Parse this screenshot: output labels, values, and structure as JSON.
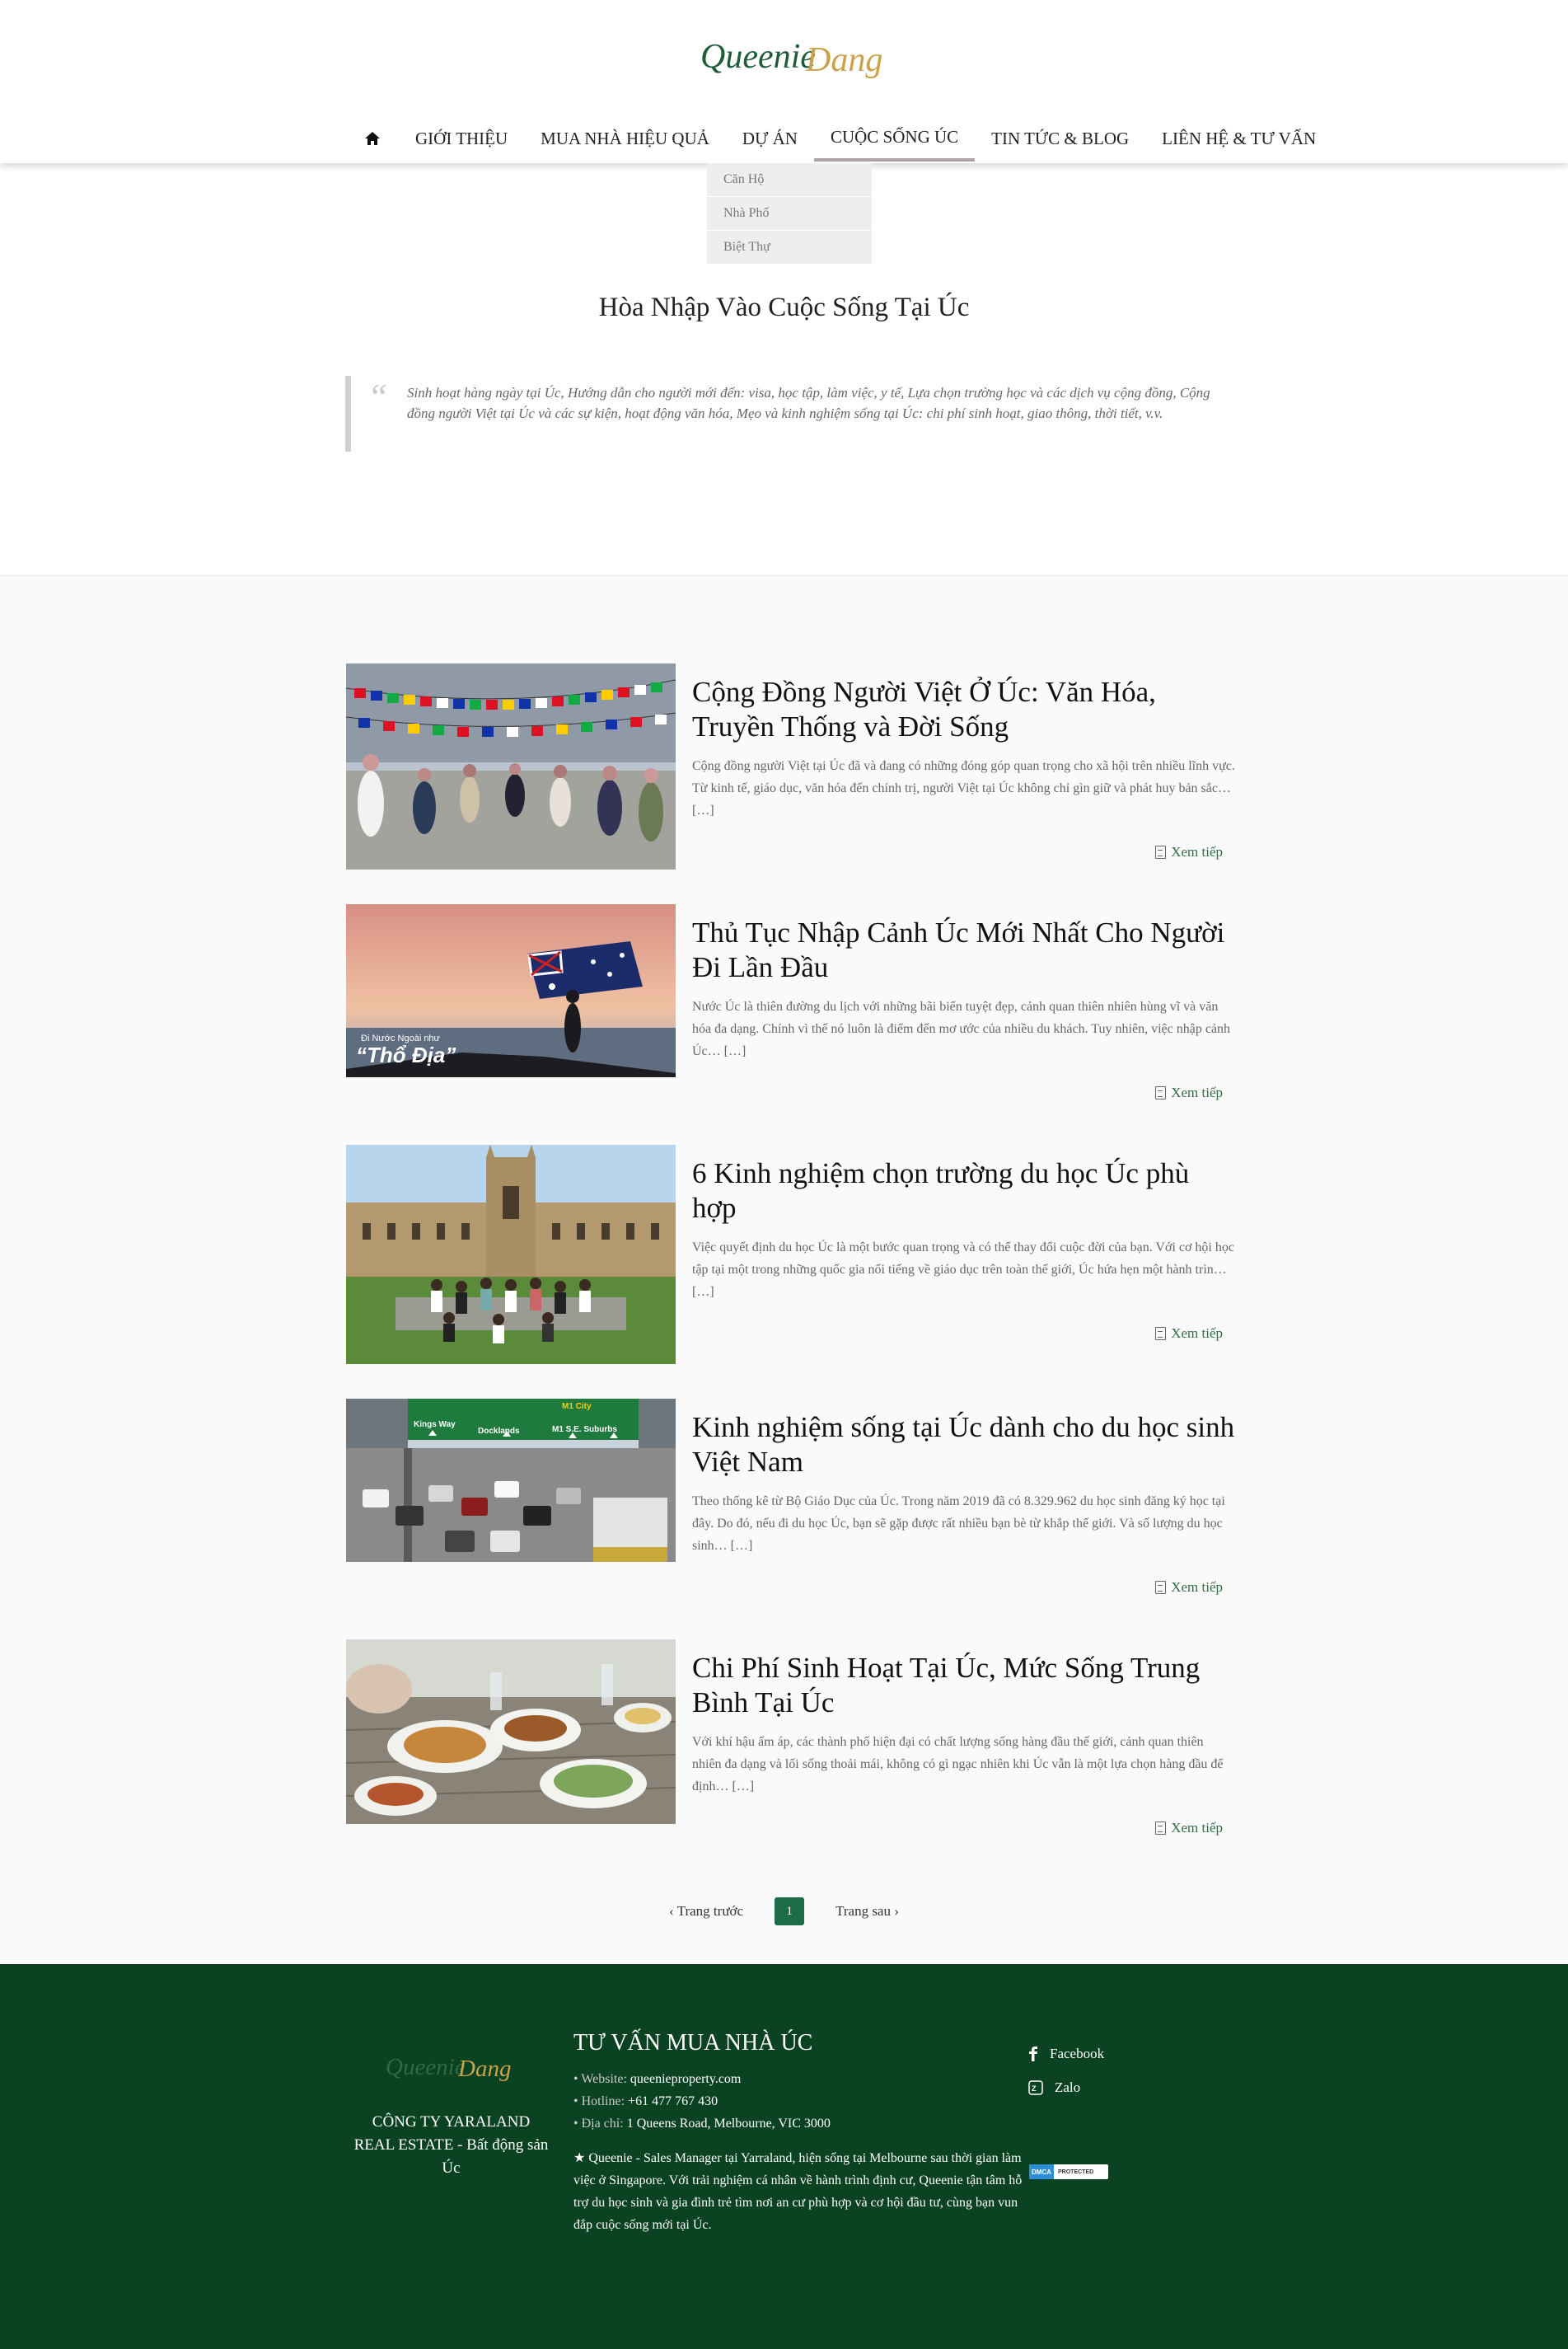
{
  "header": {
    "logo_text_1": "Queenie",
    "logo_text_2": "Dang",
    "nav": [
      {
        "label": "Giới thiệu"
      },
      {
        "label": "Mua nhà hiệu quả"
      },
      {
        "label": "Dự án"
      },
      {
        "label": "Cuộc sống Úc"
      },
      {
        "label": "Tin tức & Blog"
      },
      {
        "label": "Liên hệ & Tư vấn"
      }
    ],
    "dropdown": [
      "Căn Hộ",
      "Nhà Phố",
      "Biệt Thự"
    ]
  },
  "intro": {
    "title": "Hòa Nhập Vào Cuộc Sống Tại Úc",
    "quote": "Sinh hoạt hàng ngày tại Úc, Hướng dẫn cho người mới đến: visa, học tập, làm việc, y tế, Lựa chọn trường học và các dịch vụ cộng đồng, Cộng đồng người Việt tại Úc và các sự kiện, hoạt động văn hóa, Mẹo và kinh nghiệm sống tại Úc: chi phí sinh hoạt, giao thông, thời tiết, v.v."
  },
  "posts": [
    {
      "title": "Cộng Đồng Người Việt Ở Úc: Văn Hóa, Truyền Thống và Đời Sống",
      "excerpt": "Cộng đồng người Việt tại Úc đã và đang có những đóng góp quan trọng cho xã hội trên nhiều lĩnh vực. Từ kinh tế, giáo dục, văn hóa đến chính trị, người Việt tại Úc không chỉ gìn giữ và phát huy bản sắc… […]",
      "read_more": "Xem tiếp"
    },
    {
      "title": "Thủ Tục Nhập Cảnh Úc Mới Nhất Cho Người Đi Lần Đầu",
      "excerpt": "Nước Úc là thiên đường du lịch với những bãi biển tuyệt đẹp, cảnh quan thiên nhiên hùng vĩ và văn hóa đa dạng. Chính vì thế nó luôn là điểm đến mơ ước của nhiều du khách. Tuy nhiên, việc nhập cảnh Úc… […]",
      "read_more": "Xem tiếp",
      "image_caption_1": "Đi Nước Ngoài như",
      "image_caption_2": "“Thổ Địa”"
    },
    {
      "title": "6 Kinh nghiệm chọn trường du học Úc phù hợp",
      "excerpt": "Việc quyết định du học Úc là một bước quan trọng và có thể thay đổi cuộc đời của bạn. Với cơ hội học tập tại một trong những quốc gia nổi tiếng về giáo dục trên toàn thế giới, Úc hứa hẹn một hành trìn… […]",
      "read_more": "Xem tiếp"
    },
    {
      "title": "Kinh nghiệm sống tại Úc dành cho du học sinh Việt Nam",
      "excerpt": "Theo thống kê từ Bộ Giáo Dục của Úc. Trong năm 2019 đã có 8.329.962 du học sinh đăng ký học tại đây. Do đó, nếu đi du học Úc, bạn sẽ gặp được rất nhiều bạn bè từ khắp thế giới. Và số lượng du học sinh… […]",
      "read_more": "Xem tiếp",
      "sign_1": "Kings Way",
      "sign_2": "Docklands",
      "sign_3": "M1 City",
      "sign_4": "M1 S.E. Suburbs"
    },
    {
      "title": "Chi Phí Sinh Hoạt Tại Úc, Mức Sống Trung Bình Tại Úc",
      "excerpt": "Với khí hậu ấm áp, các thành phố hiện đại có chất lượng sống hàng đầu thế giới, cảnh quan thiên nhiên đa dạng và lối sống thoải mái, không có gì ngạc nhiên khi Úc vẫn là một lựa chọn hàng đầu để định… […]",
      "read_more": "Xem tiếp"
    }
  ],
  "pagination": {
    "prev": "Trang trước",
    "current": "1",
    "next": "Trang sau"
  },
  "footer": {
    "company": "CÔNG TY YARALAND REAL ESTATE - Bất động sản Úc",
    "heading": "TƯ VẤN MUA NHÀ ÚC",
    "website_label": "• Website:",
    "website": "queenieproperty.com",
    "hotline_label": "• Hotline:",
    "hotline": "+61 477 767 430",
    "address_label": "• Địa chỉ:",
    "address": "1 Queens Road, Melbourne, VIC 3000",
    "about": "★ Queenie - Sales Manager tại Yarraland, hiện sống tại Melbourne sau thời gian làm việc ở Singapore. Với trải nghiệm cá nhân về hành trình định cư, Queenie tận tâm hỗ trợ du học sinh và gia đình trẻ tìm nơi an cư phù hợp và cơ hội đầu tư, cùng bạn vun đắp cuộc sống mới tại Úc.",
    "social": [
      {
        "label": "Facebook",
        "icon": "facebook-icon"
      },
      {
        "label": "Zalo",
        "icon": "zalo-icon"
      }
    ],
    "dmca_left": "DMCA",
    "dmca_right": "PROTECTED"
  },
  "colors": {
    "footer_bg": "#0a4222",
    "accent_green": "#1e6b47",
    "link_green": "#2e6e45",
    "logo_green": "#1f5c3a",
    "logo_gold": "#c9a24a"
  }
}
